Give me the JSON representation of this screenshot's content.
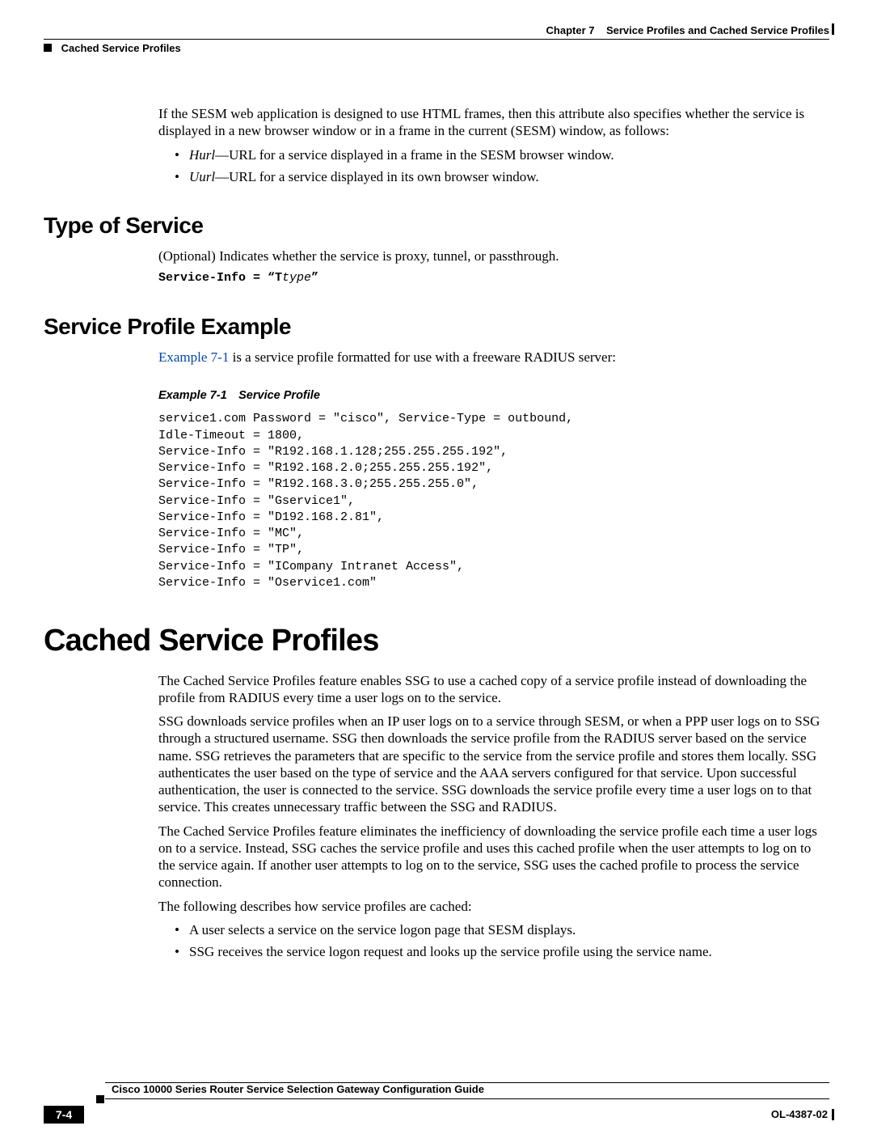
{
  "header": {
    "chapter_label": "Chapter 7",
    "chapter_title": "Service Profiles and Cached Service Profiles",
    "section": "Cached Service Profiles"
  },
  "intro": {
    "p1": "If the SESM web application is designed to use HTML frames, then this attribute also specifies whether the service is displayed in a new browser window or in a frame in the current (SESM) window, as follows:",
    "bullets": [
      {
        "term": "Hurl",
        "rest": "—URL for a service displayed in a frame in the SESM browser window."
      },
      {
        "term": "Uurl",
        "rest": "—URL for a service displayed in its own browser window."
      }
    ]
  },
  "type_of_service": {
    "heading": "Type of Service",
    "p": "(Optional) Indicates whether the service is proxy, tunnel, or passthrough.",
    "code_prefix": "Service-Info = “T",
    "code_italic": "type",
    "code_suffix": "”"
  },
  "profile_example": {
    "heading": "Service Profile Example",
    "link_text": "Example 7-1",
    "p_rest": " is a service profile formatted for use with a freeware RADIUS server:",
    "ex_title": "Example 7-1 Service Profile",
    "code": "service1.com Password = \"cisco\", Service-Type = outbound,\nIdle-Timeout = 1800,\nService-Info = \"R192.168.1.128;255.255.255.192\",\nService-Info = \"R192.168.2.0;255.255.255.192\",\nService-Info = \"R192.168.3.0;255.255.255.0\",\nService-Info = \"Gservice1\",\nService-Info = \"D192.168.2.81\",\nService-Info = \"MC\",\nService-Info = \"TP\",\nService-Info = \"ICompany Intranet Access\",\nService-Info = \"Oservice1.com\""
  },
  "cached": {
    "heading": "Cached Service Profiles",
    "p1": "The Cached Service Profiles feature enables SSG to use a cached copy of a service profile instead of downloading the profile from RADIUS every time a user logs on to the service.",
    "p2": "SSG downloads service profiles when an IP user logs on to a service through SESM, or when a PPP user logs on to SSG through a structured username. SSG then downloads the service profile from the RADIUS server based on the service name. SSG retrieves the parameters that are specific to the service from the service profile and stores them locally. SSG authenticates the user based on the type of service and the AAA servers configured for that service. Upon successful authentication, the user is connected to the service. SSG downloads the service profile every time a user logs on to that service. This creates unnecessary traffic between the SSG and RADIUS.",
    "p3": "The Cached Service Profiles feature eliminates the inefficiency of downloading the service profile each time a user logs on to a service. Instead, SSG caches the service profile and uses this cached profile when the user attempts to log on to the service again. If another user attempts to log on to the service, SSG uses the cached profile to process the service connection.",
    "p4": "The following describes how service profiles are cached:",
    "bullets": [
      "A user selects a service on the service logon page that SESM displays.",
      "SSG receives the service logon request and looks up the service profile using the service name."
    ]
  },
  "footer": {
    "book": "Cisco 10000 Series Router Service Selection Gateway Configuration Guide",
    "doc": "OL-4387-02",
    "page": "7-4"
  }
}
